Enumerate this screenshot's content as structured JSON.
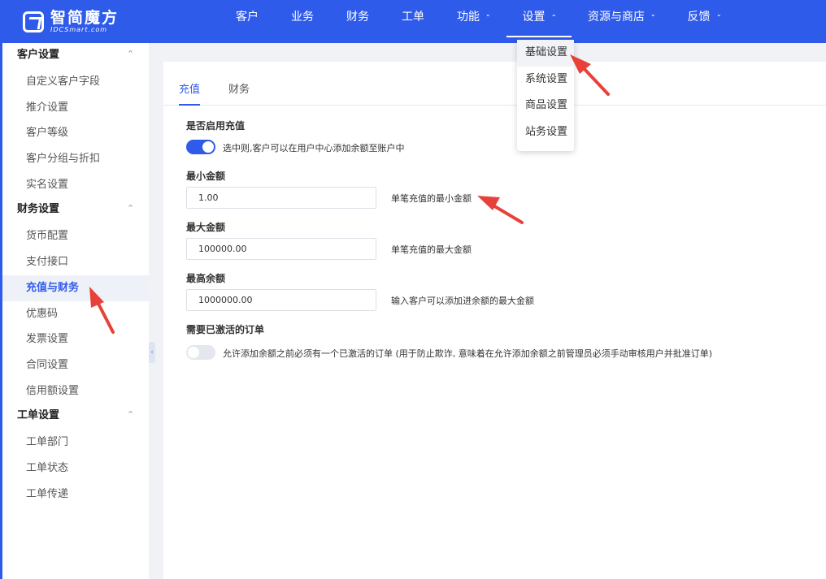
{
  "logo": {
    "title": "智简魔方",
    "subtitle": "IDCSmart.com"
  },
  "nav": [
    {
      "label": "客户",
      "dropdown": false
    },
    {
      "label": "业务",
      "dropdown": false
    },
    {
      "label": "财务",
      "dropdown": false
    },
    {
      "label": "工单",
      "dropdown": false
    },
    {
      "label": "功能",
      "dropdown": true,
      "chevron": "˅"
    },
    {
      "label": "设置",
      "dropdown": true,
      "chevron": "˄",
      "active": true
    },
    {
      "label": "资源与商店",
      "dropdown": true,
      "chevron": "˅"
    },
    {
      "label": "反馈",
      "dropdown": true,
      "chevron": "˅"
    }
  ],
  "settings_menu": [
    "基础设置",
    "系统设置",
    "商品设置",
    "站务设置"
  ],
  "sidebar": {
    "groups": [
      {
        "title": "客户设置",
        "caret": "˄",
        "items": [
          "自定义客户字段",
          "推介设置",
          "客户等级",
          "客户分组与折扣",
          "实名设置"
        ]
      },
      {
        "title": "财务设置",
        "caret": "˄",
        "items": [
          "货币配置",
          "支付接口",
          "充值与财务",
          "优惠码",
          "发票设置",
          "合同设置",
          "信用额设置"
        ]
      },
      {
        "title": "工单设置",
        "caret": "˄",
        "items": [
          "工单部门",
          "工单状态",
          "工单传递"
        ]
      }
    ],
    "active_item": "充值与财务",
    "collapse_glyph": "‹"
  },
  "tabs": [
    "充值",
    "财务"
  ],
  "form": {
    "enable_label": "是否启用充值",
    "enable_text": "选中则,客户可以在用户中心添加余额至账户中",
    "enable_on": true,
    "min_label": "最小金额",
    "min_value": "1.00",
    "min_hint": "单笔充值的最小金额",
    "max_label": "最大金额",
    "max_value": "100000.00",
    "max_hint": "单笔充值的最大金额",
    "balance_label": "最高余额",
    "balance_value": "1000000.00",
    "balance_hint": "输入客户可以添加进余额的最大金额",
    "order_label": "需要已激活的订单",
    "order_text": "允许添加余额之前必须有一个已激活的订单 (用于防止欺诈, 意味着在允许添加余额之前管理员必须手动审核用户并批准订单)",
    "order_on": false
  },
  "colors": {
    "primary": "#2f5bea",
    "arrow": "#e8413a"
  }
}
